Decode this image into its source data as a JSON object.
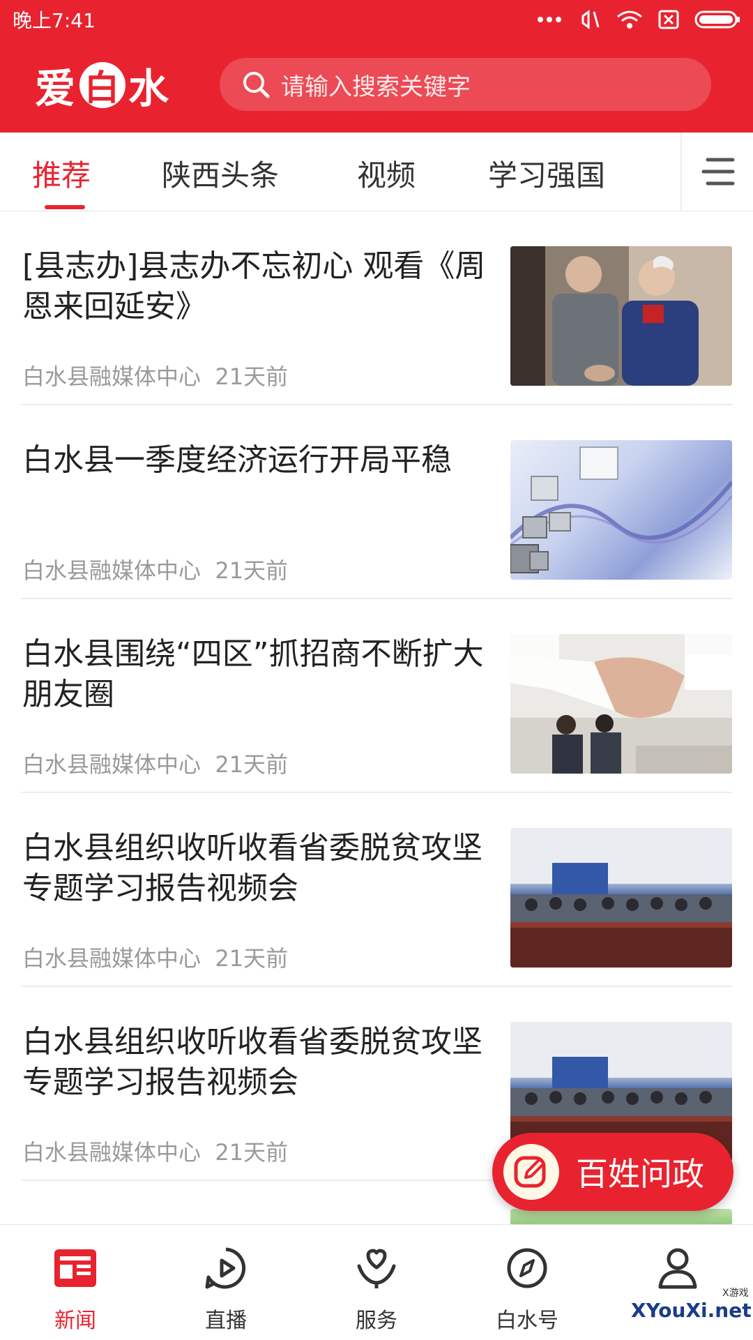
{
  "status_bar": {
    "time": "晚上7:41",
    "icons": [
      "more-dots-icon",
      "mute-icon",
      "wifi-icon",
      "no-sim-icon",
      "battery-icon"
    ]
  },
  "header": {
    "logo_text_left": "爱",
    "logo_text_circle": "白",
    "logo_text_right": "水",
    "search_placeholder": "请输入搜索关键字",
    "accent_color": "#e8232f"
  },
  "tabs": [
    {
      "label": "推荐",
      "active": true
    },
    {
      "label": "陕西头条",
      "active": false
    },
    {
      "label": "视频",
      "active": false
    },
    {
      "label": "学习强国",
      "active": false
    }
  ],
  "news": [
    {
      "title": "[县志办]县志办不忘初心 观看《周恩来回延安》",
      "source": "白水县融媒体中心",
      "time": "21天前"
    },
    {
      "title": "白水县一季度经济运行开局平稳",
      "source": "白水县融媒体中心",
      "time": "21天前"
    },
    {
      "title": "白水县围绕“四区”抓招商不断扩大朋友圈",
      "source": "白水县融媒体中心",
      "time": "21天前"
    },
    {
      "title": "白水县组织收听收看省委脱贫攻坚专题学习报告视频会",
      "source": "白水县融媒体中心",
      "time": "21天前"
    },
    {
      "title": "白水县组织收听收看省委脱贫攻坚专题学习报告视频会",
      "source": "白水县融媒体中心",
      "time": "21天前"
    }
  ],
  "fab": {
    "label": "百姓问政"
  },
  "bottom_nav": [
    {
      "label": "新闻",
      "icon": "news-icon",
      "active": true
    },
    {
      "label": "直播",
      "icon": "play-icon",
      "active": false
    },
    {
      "label": "服务",
      "icon": "service-icon",
      "active": false
    },
    {
      "label": "白水号",
      "icon": "compass-icon",
      "active": false
    },
    {
      "label": "我的",
      "icon": "user-icon",
      "active": false
    }
  ],
  "watermark": {
    "text": "XYouXi.net",
    "small": "X游戏"
  }
}
